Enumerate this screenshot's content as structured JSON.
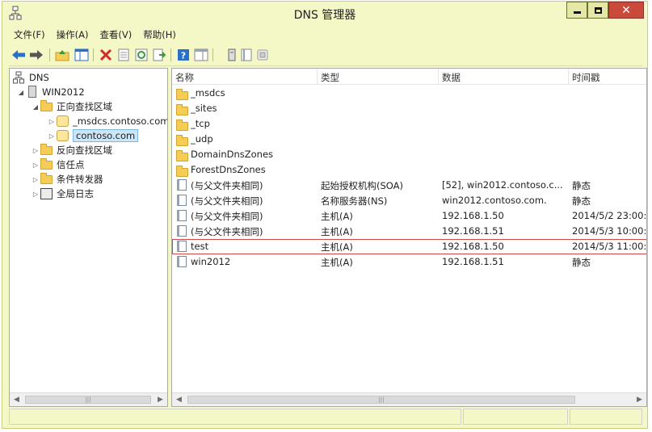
{
  "window": {
    "title": "DNS 管理器"
  },
  "menu": {
    "items": [
      "文件(F)",
      "操作(A)",
      "查看(V)",
      "帮助(H)"
    ]
  },
  "toolbar": {
    "icons": [
      "back-arrow-icon",
      "forward-arrow-icon",
      "up-folder-icon",
      "show-hide-tree-icon",
      "delete-icon",
      "properties-icon",
      "refresh-icon",
      "export-icon",
      "help-icon",
      "action-pane-icon",
      "server-icon",
      "list-icon",
      "zone-icon"
    ],
    "accent_blue": "#2a6fc9",
    "delete_red": "#d42a2a"
  },
  "tree": {
    "root": "DNS",
    "server": "WIN2012",
    "forward_zones": "正向查找区域",
    "msdcs_zone": "_msdcs.contoso.com",
    "contoso_zone": "contoso.com",
    "reverse_zones": "反向查找区域",
    "trust_points": "信任点",
    "conditional_forwarders": "条件转发器",
    "global_logs": "全局日志"
  },
  "list": {
    "columns": [
      "名称",
      "类型",
      "数据",
      "时间戳"
    ],
    "folders": [
      "_msdcs",
      "_sites",
      "_tcp",
      "_udp",
      "DomainDnsZones",
      "ForestDnsZones"
    ],
    "records": [
      {
        "name": "(与父文件夹相同)",
        "type": "起始授权机构(SOA)",
        "data": "[52], win2012.contoso.c...",
        "timestamp": "静态"
      },
      {
        "name": "(与父文件夹相同)",
        "type": "名称服务器(NS)",
        "data": "win2012.contoso.com.",
        "timestamp": "静态"
      },
      {
        "name": "(与父文件夹相同)",
        "type": "主机(A)",
        "data": "192.168.1.50",
        "timestamp": "2014/5/2 23:00:..."
      },
      {
        "name": "(与父文件夹相同)",
        "type": "主机(A)",
        "data": "192.168.1.51",
        "timestamp": "2014/5/3 10:00:..."
      },
      {
        "name": "test",
        "type": "主机(A)",
        "data": "192.168.1.50",
        "timestamp": "2014/5/3 11:00:..."
      },
      {
        "name": "win2012",
        "type": "主机(A)",
        "data": "192.168.1.51",
        "timestamp": "静态"
      }
    ],
    "highlight_color": "#d04848"
  },
  "theme": {
    "frame": "#f4f7c6",
    "close_button": "#c94a3a"
  }
}
